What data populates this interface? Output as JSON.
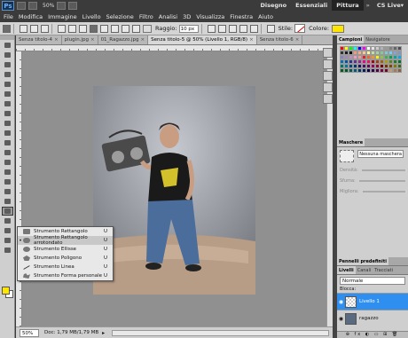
{
  "appbar": {
    "logo": "Ps",
    "zoom": "50%",
    "workspaces": [
      "Disegno",
      "Essenziali",
      "Pittura"
    ],
    "active_workspace": "Pittura",
    "more": "»",
    "cslive": "CS Live▾"
  },
  "menu": [
    "File",
    "Modifica",
    "Immagine",
    "Livello",
    "Selezione",
    "Filtro",
    "Analisi",
    "3D",
    "Visualizza",
    "Finestra",
    "Aiuto"
  ],
  "options": {
    "radius_label": "Raggio:",
    "radius_value": "10 px",
    "style_label": "Stile:",
    "color_label": "Colore:",
    "color": "#ffe600"
  },
  "tabs": [
    {
      "label": "Senza titolo-4",
      "close": "×"
    },
    {
      "label": "plugin.jpg",
      "close": "×"
    },
    {
      "label": "01_Ragazzo.jpg",
      "close": "×"
    },
    {
      "label": "Senza titolo-5 @ 50% (Livello 1, RGB/8)",
      "close": "×"
    },
    {
      "label": "Senza titolo-6",
      "close": "×"
    }
  ],
  "flyout": [
    {
      "label": "Strumento Rettangolo",
      "key": "U",
      "selected": false
    },
    {
      "label": "Strumento Rettangolo arrotondato",
      "key": "U",
      "selected": true
    },
    {
      "label": "Strumento Ellisse",
      "key": "U",
      "selected": false
    },
    {
      "label": "Strumento Poligono",
      "key": "U",
      "selected": false
    },
    {
      "label": "Strumento Linea",
      "key": "U",
      "selected": false
    },
    {
      "label": "Strumento Forma personale",
      "key": "U",
      "selected": false
    }
  ],
  "status": {
    "zoom": "50%",
    "doc": "Doc: 1,79 MB/1,79 MB",
    "arrow": "▸"
  },
  "panels": {
    "swatch_tabs": [
      "Campioni",
      "Navigatore"
    ],
    "masks_title": "Maschere",
    "no_mask": "Nessuna maschera selezionata",
    "mask_rows": [
      "Densità:",
      "Sfuma:",
      "Migliora:"
    ],
    "presets_title": "Pennelli predefiniti",
    "layer_tabs": [
      "Livelli",
      "Canali",
      "Tracciati"
    ],
    "blend_mode": "Normale",
    "lock_label": "Blocca:",
    "layers": [
      {
        "name": "Livello 1",
        "selected": true
      },
      {
        "name": "ragazzo",
        "selected": false
      }
    ],
    "footer_icons": "⊕ fx ◐ ▭ ⊞ 🗑"
  },
  "swatch_colors": [
    "#ff0000",
    "#ffff00",
    "#00ff00",
    "#00ffff",
    "#0000ff",
    "#ff00ff",
    "#ffffff",
    "#e5e5e5",
    "#cccccc",
    "#b3b3b3",
    "#999999",
    "#808080",
    "#666666",
    "#4d4d4d",
    "#333333",
    "#1a1a1a",
    "#000000",
    "#f7977a",
    "#f9ad81",
    "#fdc68a",
    "#fff79a",
    "#c4df9b",
    "#a2d39c",
    "#82ca9d",
    "#7bcdc8",
    "#6ecff6",
    "#7ea7d8",
    "#8493ca",
    "#8882be",
    "#a187be",
    "#bc8dbf",
    "#f49ac2",
    "#f6989d",
    "#ed1c24",
    "#f26522",
    "#f7941d",
    "#fff200",
    "#8dc73f",
    "#39b54a",
    "#00a651",
    "#00a99d",
    "#00aeef",
    "#0072bc",
    "#0054a6",
    "#2e3192",
    "#662d91",
    "#92278f",
    "#ec008c",
    "#ed145b",
    "#9e0b0f",
    "#a0410d",
    "#a3620a",
    "#aba000",
    "#598527",
    "#197b30",
    "#007236",
    "#00746b",
    "#0076a3",
    "#004a80",
    "#003471",
    "#1b1464",
    "#440e62",
    "#630460",
    "#9e005d",
    "#9e0039",
    "#790000",
    "#7b2e00",
    "#7d4900",
    "#827b00",
    "#406618",
    "#005e20",
    "#005826",
    "#005952",
    "#005b7f",
    "#003663",
    "#002157",
    "#0d004c",
    "#32004b",
    "#4b0049",
    "#7b0046",
    "#7a0026",
    "#c69c6d",
    "#a67c52",
    "#8c6239"
  ],
  "tool_icons": [
    "move-icon",
    "marquee-icon",
    "lasso-icon",
    "magic-wand-icon",
    "crop-icon",
    "eyedropper-icon",
    "healing-icon",
    "brush-icon",
    "clone-stamp-icon",
    "history-brush-icon",
    "eraser-icon",
    "gradient-icon",
    "blur-icon",
    "dodge-icon",
    "pen-icon",
    "type-icon",
    "path-select-icon",
    "shape-icon",
    "3d-rotate-icon",
    "3d-camera-icon",
    "hand-icon",
    "zoom-icon"
  ]
}
